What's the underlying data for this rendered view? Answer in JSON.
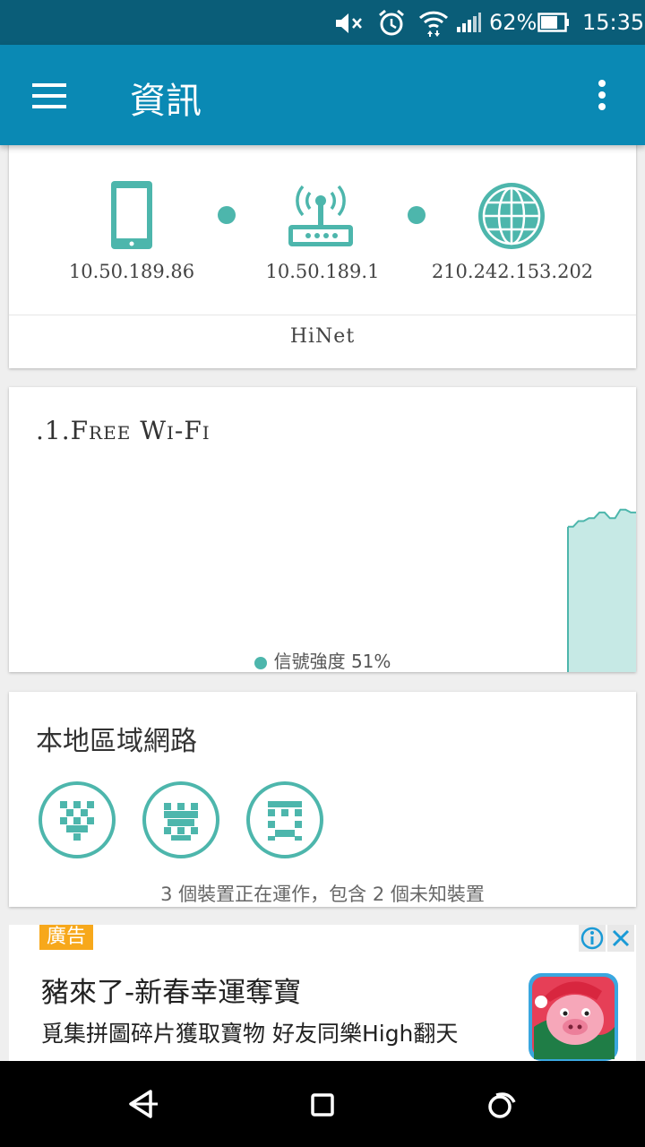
{
  "status_bar": {
    "battery": "62%",
    "time": "15:35",
    "icons": [
      "mute-icon",
      "alarm-icon",
      "wifi-icon",
      "signal-icon",
      "battery-icon"
    ]
  },
  "app_bar": {
    "title": "資訊",
    "icons": [
      "menu-icon",
      "more-vert-icon"
    ]
  },
  "connection": {
    "device_ip": "10.50.189.86",
    "router_ip": "10.50.189.1",
    "public_ip": "210.242.153.202",
    "isp": "HiNet",
    "icons": [
      "phone-icon",
      "router-icon",
      "globe-icon"
    ]
  },
  "wifi": {
    "ssid": ".1.Free Wi-Fi",
    "legend_label": "信號強度",
    "signal_strength": "51%"
  },
  "chart_data": {
    "type": "area",
    "series": [
      {
        "values": [
          51,
          51,
          53,
          53,
          54,
          54,
          56,
          56,
          54,
          54,
          57,
          57,
          56,
          56
        ]
      }
    ],
    "ylim": [
      0,
      100
    ]
  },
  "lan": {
    "title": "本地區域網路",
    "device_icons": [
      "device-avatar-1-icon",
      "device-avatar-2-icon",
      "device-avatar-3-icon"
    ],
    "summary": "3 個裝置正在運作，包含 2 個未知裝置"
  },
  "ad": {
    "badge": "廣告",
    "title": "豬來了-新春幸運奪寶",
    "subtitle": "覓集拼圖碎片獲取寶物 好友同樂High翻天",
    "icons": [
      "ad-info-icon",
      "ad-close-icon",
      "ad-app-icon"
    ]
  },
  "colors": {
    "status_bar": "#0a5d78",
    "app_bar": "#0a89b4",
    "accent": "#4db6ac",
    "ad_badge": "#f7a81b"
  }
}
